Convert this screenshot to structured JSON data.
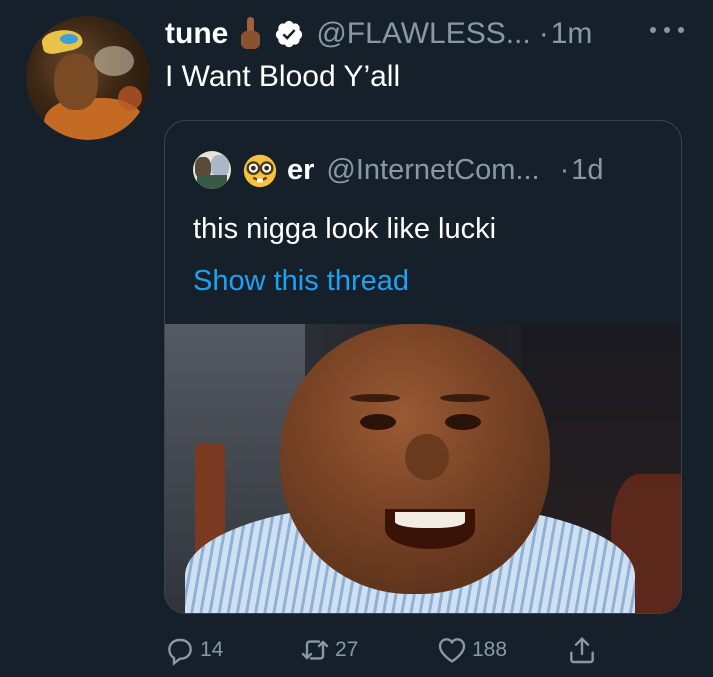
{
  "tweet": {
    "display_name": "tune",
    "handle": "@FLAWLESS...",
    "separator": "·",
    "time": "1m",
    "text": "I Want Blood Y’all"
  },
  "quote": {
    "display_name": "er",
    "handle": "@InternetCom...",
    "separator": "·",
    "time": "1d",
    "text": "this nigga look like lucki",
    "thread_link": "Show this thread"
  },
  "actions": {
    "replies": "14",
    "retweets": "27",
    "likes": "188"
  },
  "colors": {
    "background": "#15202b",
    "secondary_text": "#8899a6",
    "link": "#1da1f2",
    "verified": "#ffffff",
    "border": "#38444d"
  }
}
